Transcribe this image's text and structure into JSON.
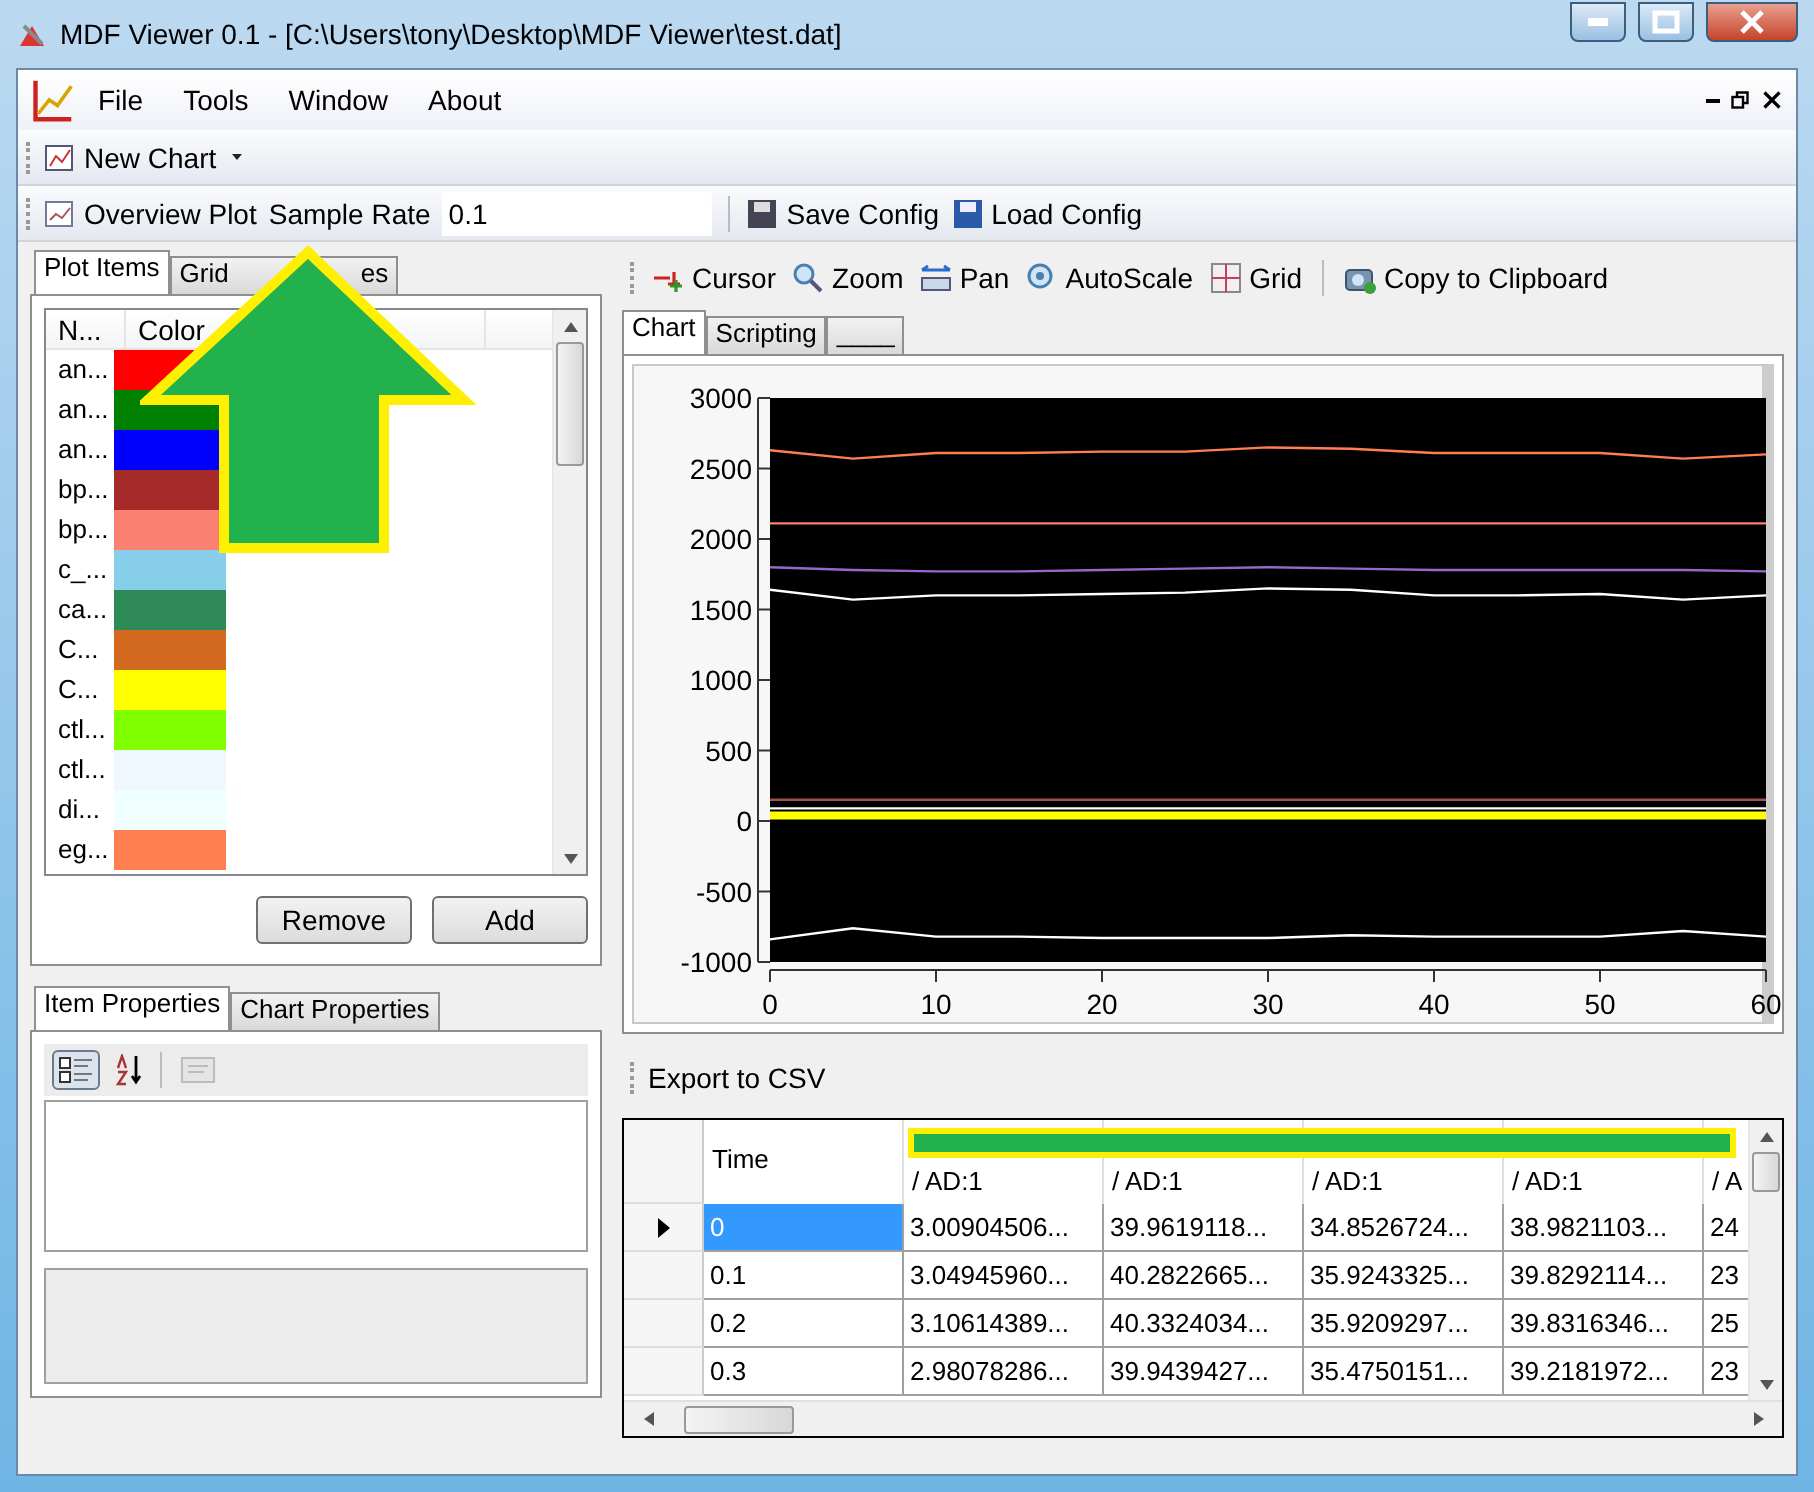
{
  "window": {
    "title": "MDF Viewer 0.1 - [C:\\Users\\tony\\Desktop\\MDF Viewer\\test.dat]"
  },
  "menu": [
    "File",
    "Tools",
    "Window",
    "About"
  ],
  "new_chart": {
    "label": "New Chart"
  },
  "toolbar": {
    "overview": "Overview Plot",
    "sample_rate_label": "Sample Rate",
    "sample_rate_value": "0.1",
    "save": "Save Config",
    "load": "Load Config"
  },
  "left_tabs": [
    {
      "parts": [
        "Plot Items"
      ],
      "selected": true
    },
    {
      "parts": [
        "Grid",
        "es"
      ],
      "selected": false
    }
  ],
  "plot_items": {
    "columns": [
      "N...",
      "Color"
    ],
    "rows": [
      {
        "name": "an...",
        "color": "#ff0000"
      },
      {
        "name": "an...",
        "color": "#008000"
      },
      {
        "name": "an...",
        "color": "#0000ff"
      },
      {
        "name": "bp...",
        "color": "#a52a2a"
      },
      {
        "name": "bp...",
        "color": "#fa8072"
      },
      {
        "name": "c_...",
        "color": "#87ceeb"
      },
      {
        "name": "ca...",
        "color": "#2e8b57"
      },
      {
        "name": "C...",
        "color": "#d2691e"
      },
      {
        "name": "C...",
        "color": "#ffff00"
      },
      {
        "name": "ctl...",
        "color": "#7fff00"
      },
      {
        "name": "ctl...",
        "color": "#f0f8ff"
      },
      {
        "name": "di...",
        "color": "#f0ffff"
      },
      {
        "name": "eg...",
        "color": "#ff7f50"
      }
    ],
    "buttons": [
      "Remove",
      "Add"
    ]
  },
  "prop_tabs": [
    {
      "label": "Item Properties",
      "selected": true
    },
    {
      "label": "Chart Properties",
      "selected": false
    }
  ],
  "prop_toolbar": {
    "categorized_pressed": true,
    "pages_disabled": true
  },
  "chart_toolbar": [
    "Cursor",
    "Zoom",
    "Pan",
    "AutoScale",
    "Grid",
    "Copy to Clipboard"
  ],
  "chart_tabs": [
    {
      "label": "Chart",
      "selected": true
    },
    {
      "label": "Scripting",
      "selected": false
    },
    {
      "label": "____",
      "selected": false
    }
  ],
  "chart_data": {
    "type": "line",
    "x": [
      0,
      5,
      10,
      15,
      20,
      25,
      30,
      35,
      40,
      45,
      50,
      55,
      60
    ],
    "xlim": [
      0,
      60
    ],
    "ylim": [
      -1000,
      3000
    ],
    "xticks": [
      0,
      10,
      20,
      30,
      40,
      50,
      60
    ],
    "yticks": [
      -1000,
      -500,
      0,
      500,
      1000,
      1500,
      2000,
      2500,
      3000
    ],
    "series": [
      {
        "color": "#ff7f50",
        "values": [
          2630,
          2570,
          2610,
          2610,
          2620,
          2620,
          2650,
          2640,
          2610,
          2610,
          2610,
          2570,
          2600
        ]
      },
      {
        "color": "#fa8072",
        "values": [
          2110,
          2110,
          2110,
          2110,
          2110,
          2110,
          2110,
          2110,
          2110,
          2110,
          2110,
          2110,
          2110
        ]
      },
      {
        "color": "#9966cc",
        "values": [
          1800,
          1780,
          1770,
          1770,
          1780,
          1790,
          1800,
          1790,
          1780,
          1780,
          1780,
          1780,
          1770
        ]
      },
      {
        "color": "#ffffff",
        "values": [
          1640,
          1570,
          1600,
          1600,
          1610,
          1620,
          1650,
          1640,
          1600,
          1600,
          1610,
          1570,
          1600
        ]
      },
      {
        "color": "#a0504a",
        "values": [
          150,
          150,
          150,
          150,
          150,
          150,
          150,
          150,
          150,
          150,
          150,
          150,
          150
        ]
      },
      {
        "color": "#ffffff",
        "values": [
          90,
          90,
          90,
          90,
          90,
          90,
          90,
          90,
          90,
          90,
          90,
          90,
          90
        ]
      },
      {
        "color": "#ffff00",
        "values": [
          40,
          40,
          40,
          40,
          40,
          40,
          40,
          40,
          40,
          40,
          40,
          40,
          40
        ]
      },
      {
        "color": "#ffffff",
        "values": [
          -840,
          -760,
          -820,
          -820,
          -830,
          -830,
          -830,
          -810,
          -820,
          -820,
          -820,
          -780,
          -820
        ]
      }
    ]
  },
  "export": "Export to CSV",
  "table": {
    "columns": [
      "Time",
      "/ AD:1",
      "/ AD:1",
      "/ AD:1",
      "/ AD:1",
      "/ A"
    ],
    "rows": [
      {
        "selected": true,
        "cells": [
          "0",
          "3.00904506...",
          "39.9619118...",
          "34.8526724...",
          "38.9821103...",
          "24"
        ]
      },
      {
        "selected": false,
        "cells": [
          "0.1",
          "3.04945960...",
          "40.2822665...",
          "35.9243325...",
          "39.8292114...",
          "23"
        ]
      },
      {
        "selected": false,
        "cells": [
          "0.2",
          "3.10614389...",
          "40.3324034...",
          "35.9209297...",
          "39.8316346...",
          "25"
        ]
      },
      {
        "selected": false,
        "cells": [
          "0.3",
          "2.98078286...",
          "39.9439427...",
          "35.4750151...",
          "39.2181972...",
          "23"
        ]
      }
    ]
  }
}
